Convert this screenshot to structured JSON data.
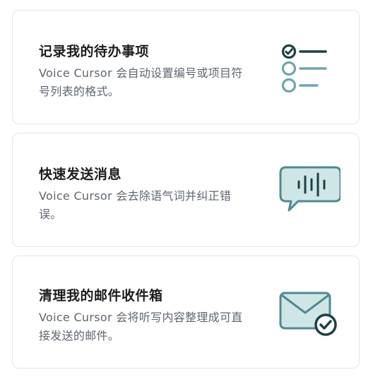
{
  "cards": [
    {
      "title": "记录我的待办事项",
      "description": "Voice Cursor 会自动设置编号或项目符号列表的格式。",
      "icon": "checklist-icon"
    },
    {
      "title": "快速发送消息",
      "description": "Voice Cursor 会去除语气词并纠正错误。",
      "icon": "voice-message-icon"
    },
    {
      "title": "清理我的邮件收件箱",
      "description": "Voice Cursor 会将听写内容整理成可直接发送的邮件。",
      "icon": "email-check-icon"
    }
  ],
  "colors": {
    "icon_dark": "#1f3f44",
    "icon_accent": "#6fa6ab",
    "icon_fill": "#cfe6e7",
    "title": "#1d1d1d",
    "description": "#5e6670",
    "card_border": "#e4e6e8"
  }
}
